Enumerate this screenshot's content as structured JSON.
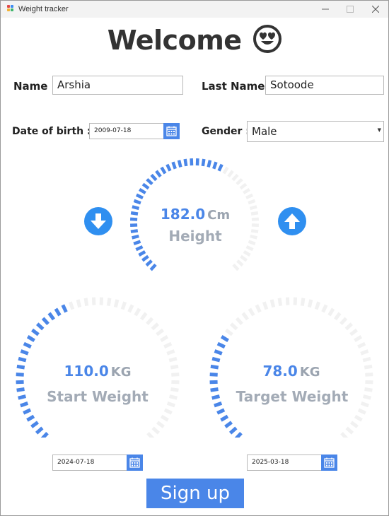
{
  "window": {
    "title": "Weight tracker",
    "controls": [
      "minimize",
      "maximize",
      "close"
    ]
  },
  "header": {
    "title": "Welcome",
    "emoji": "smiling-face-heart-eyes"
  },
  "form": {
    "name_label": "Name :",
    "name_value": "Arshia",
    "last_name_label": "Last Name :",
    "last_name_value": "Sotoode",
    "dob_label": "Date of birth :",
    "dob_value": "2009-07-18",
    "gender_label": "Gender :",
    "gender_value": "Male"
  },
  "height": {
    "value": "182.0",
    "unit": "Cm",
    "label": "Height",
    "fill_fraction": 0.6
  },
  "start_weight": {
    "value": "110.0",
    "unit": "KG",
    "label": "Start Weight",
    "fill_fraction": 0.42,
    "date": "2024-07-18"
  },
  "target_weight": {
    "value": "78.0",
    "unit": "KG",
    "label": "Target Weight",
    "fill_fraction": 0.3,
    "date": "2025-03-18"
  },
  "signup": {
    "label": "Sign up"
  },
  "colors": {
    "accent": "#4a86e8",
    "arrow_button": "#2f8ff0",
    "gauge_track": "#f1f1f1",
    "label_gray": "#a3abb6"
  }
}
